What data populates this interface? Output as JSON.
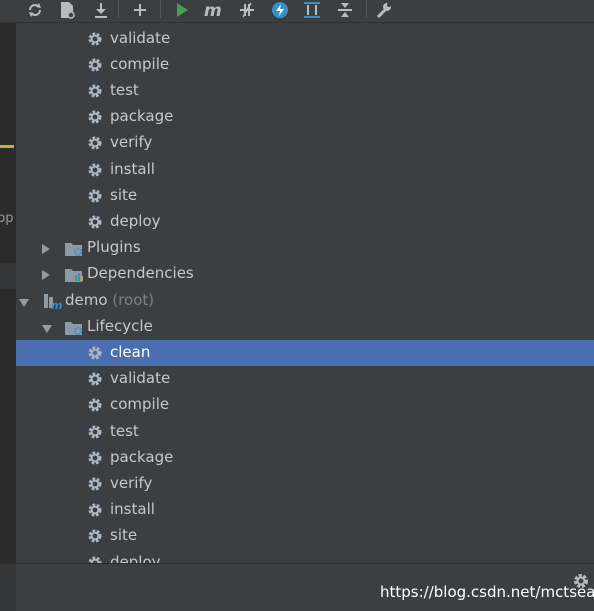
{
  "toolbar": {
    "buttons": [
      {
        "name": "reimport-icon"
      },
      {
        "name": "generate-sources-icon"
      },
      {
        "name": "download-icon"
      },
      {
        "name": "add-icon"
      },
      {
        "name": "run-icon"
      },
      {
        "name": "execute-goal-icon"
      },
      {
        "name": "toggle-offline-icon"
      },
      {
        "name": "skip-tests-icon"
      },
      {
        "name": "show-dependencies-icon"
      },
      {
        "name": "collapse-all-icon"
      },
      {
        "name": "settings-wrench-icon"
      }
    ]
  },
  "left_strip": {
    "cut_label": "pp"
  },
  "tree": {
    "rows": [
      {
        "label": "validate",
        "kind": "goal"
      },
      {
        "label": "compile",
        "kind": "goal"
      },
      {
        "label": "test",
        "kind": "goal"
      },
      {
        "label": "package",
        "kind": "goal"
      },
      {
        "label": "verify",
        "kind": "goal"
      },
      {
        "label": "install",
        "kind": "goal"
      },
      {
        "label": "site",
        "kind": "goal"
      },
      {
        "label": "deploy",
        "kind": "goal"
      },
      {
        "label": "Plugins",
        "kind": "folder"
      },
      {
        "label": "Dependencies",
        "kind": "folder"
      },
      {
        "label": "demo",
        "suffix": "(root)",
        "kind": "project"
      },
      {
        "label": "Lifecycle",
        "kind": "folder"
      },
      {
        "label": "clean",
        "kind": "goal",
        "selected": true
      },
      {
        "label": "validate",
        "kind": "goal"
      },
      {
        "label": "compile",
        "kind": "goal"
      },
      {
        "label": "test",
        "kind": "goal"
      },
      {
        "label": "package",
        "kind": "goal"
      },
      {
        "label": "verify",
        "kind": "goal"
      },
      {
        "label": "install",
        "kind": "goal"
      },
      {
        "label": "site",
        "kind": "goal"
      },
      {
        "label": "deploy",
        "kind": "goal"
      }
    ]
  },
  "watermark": "https://blog.csdn.net/mctsean",
  "colors": {
    "background": "#3c3f41",
    "selection": "#4b6eaf",
    "accent": "#d7a53d"
  }
}
